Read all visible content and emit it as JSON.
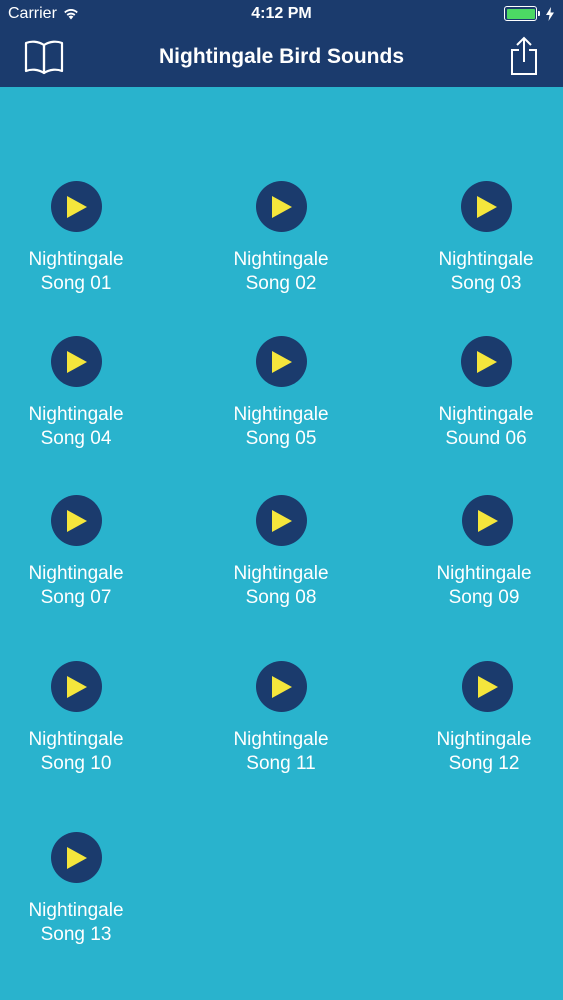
{
  "status_bar": {
    "carrier": "Carrier",
    "time": "4:12 PM"
  },
  "nav": {
    "title": "Nightingale Bird Sounds",
    "left_icon": "book-icon",
    "right_icon": "share-icon"
  },
  "colors": {
    "background": "#29b3cd",
    "navbar": "#1b3b6d",
    "play_circle": "#1b3b6d",
    "play_triangle": "#f5e63c",
    "battery": "#4cd964"
  },
  "items": [
    {
      "line1": "Nightingale",
      "line2": "Song 01"
    },
    {
      "line1": "Nightingale",
      "line2": "Song 02"
    },
    {
      "line1": "Nightingale",
      "line2": "Song 03"
    },
    {
      "line1": "Nightingale",
      "line2": "Song 04"
    },
    {
      "line1": "Nightingale",
      "line2": "Song 05"
    },
    {
      "line1": "Nightingale",
      "line2": "Sound 06"
    },
    {
      "line1": "Nightingale",
      "line2": "Song 07"
    },
    {
      "line1": "Nightingale",
      "line2": "Song 08"
    },
    {
      "line1": "Nightingale",
      "line2": "Song 09"
    },
    {
      "line1": "Nightingale",
      "line2": "Song 10"
    },
    {
      "line1": "Nightingale",
      "line2": "Song 11"
    },
    {
      "line1": "Nightingale",
      "line2": "Song 12"
    },
    {
      "line1": "Nightingale",
      "line2": "Song 13"
    }
  ]
}
